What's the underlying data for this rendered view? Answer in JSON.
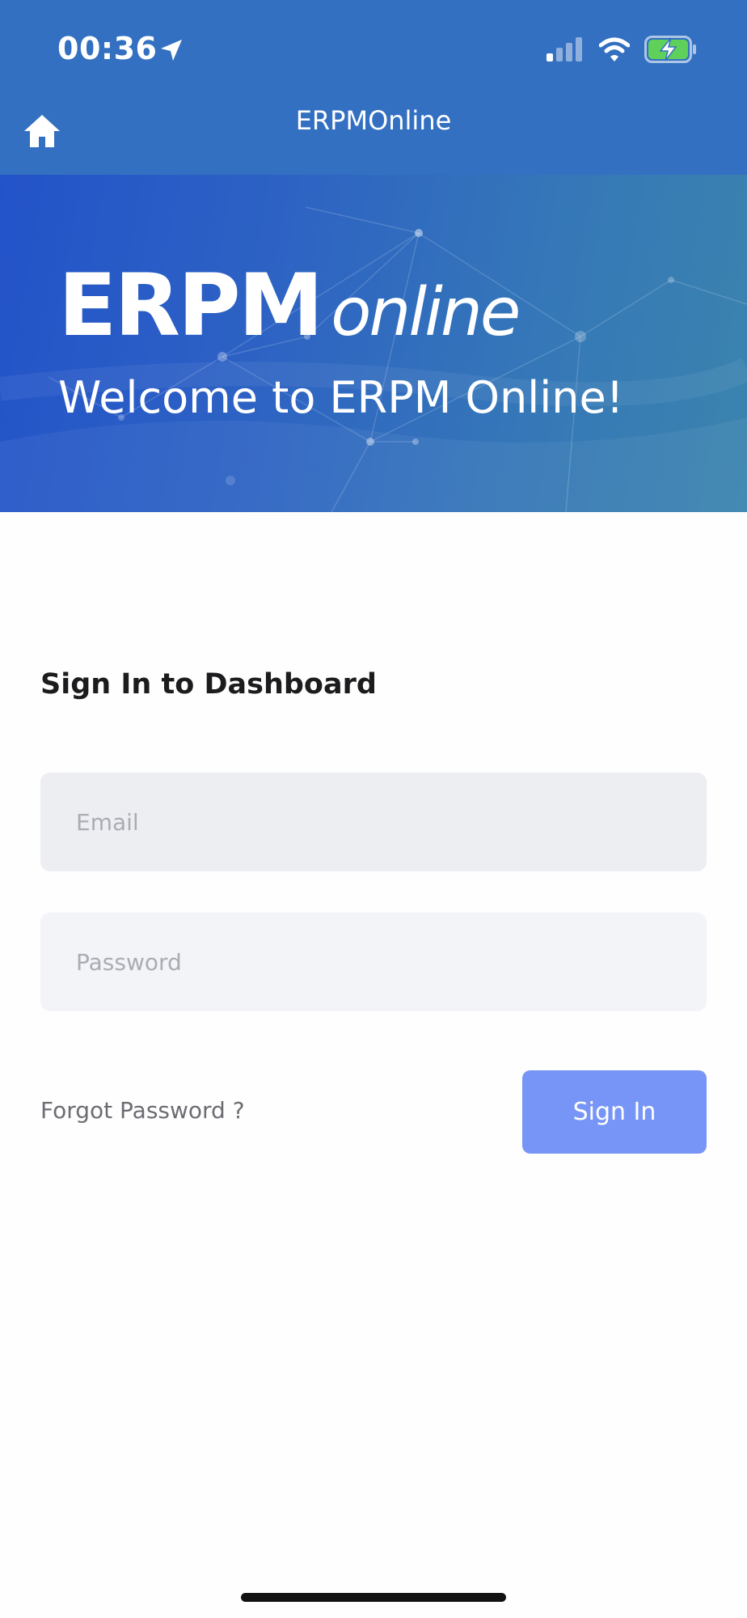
{
  "status_bar": {
    "time": "00:36",
    "icons": [
      "location-arrow-icon",
      "cellular-signal-icon",
      "wifi-icon",
      "battery-charging-icon"
    ]
  },
  "nav": {
    "title": "ERPMOnline",
    "home_icon": "home-icon"
  },
  "hero": {
    "logo_bold": "ERPM",
    "logo_light": "online",
    "welcome": "Welcome to ERPM Online!"
  },
  "form": {
    "heading": "Sign In to Dashboard",
    "email_placeholder": "Email",
    "email_value": "",
    "password_placeholder": "Password",
    "password_value": "",
    "forgot_label": "Forgot Password ?",
    "signin_label": "Sign In"
  },
  "colors": {
    "topbar": "#3370c1",
    "hero_start": "#2353c9",
    "hero_end": "#3b84ae",
    "primary_button": "#7795f7",
    "input_bg": "#eceef2",
    "battery_green": "#5fd15a"
  }
}
